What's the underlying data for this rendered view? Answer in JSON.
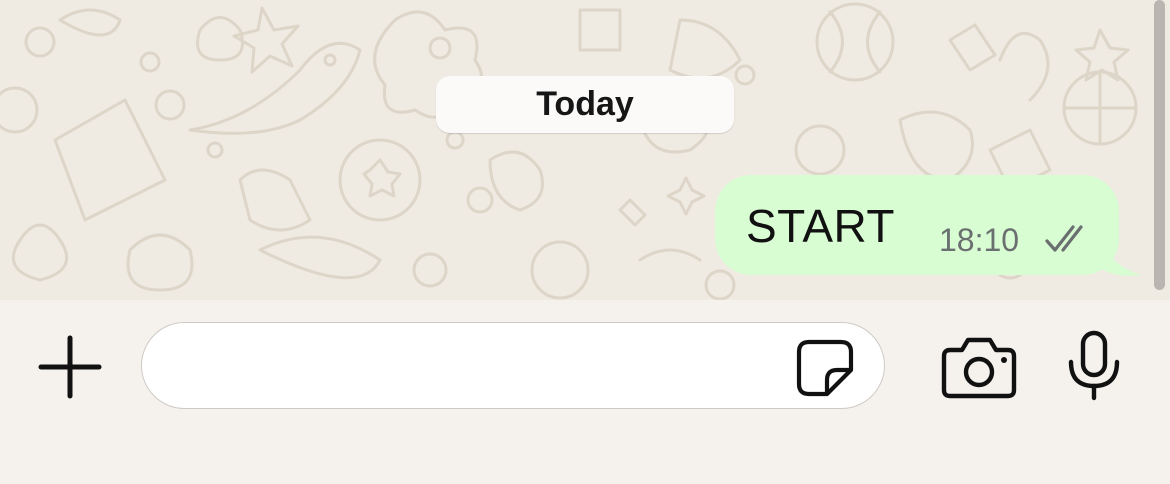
{
  "chat": {
    "date_separator": "Today",
    "messages": [
      {
        "direction": "outgoing",
        "text": "START",
        "time": "18:10",
        "status": "read",
        "status_icon": "double-check-icon"
      }
    ]
  },
  "composer": {
    "input_value": "",
    "input_placeholder": "",
    "icons": {
      "attach": "plus-icon",
      "sticker": "sticker-icon",
      "camera": "camera-icon",
      "voice": "microphone-icon"
    }
  },
  "colors": {
    "chat_background": "#efeae2",
    "outgoing_bubble": "#d9fdd3",
    "composer_background": "#f5f2ee",
    "date_chip": "#fbfaf9",
    "timestamp": "#6a6f70"
  }
}
